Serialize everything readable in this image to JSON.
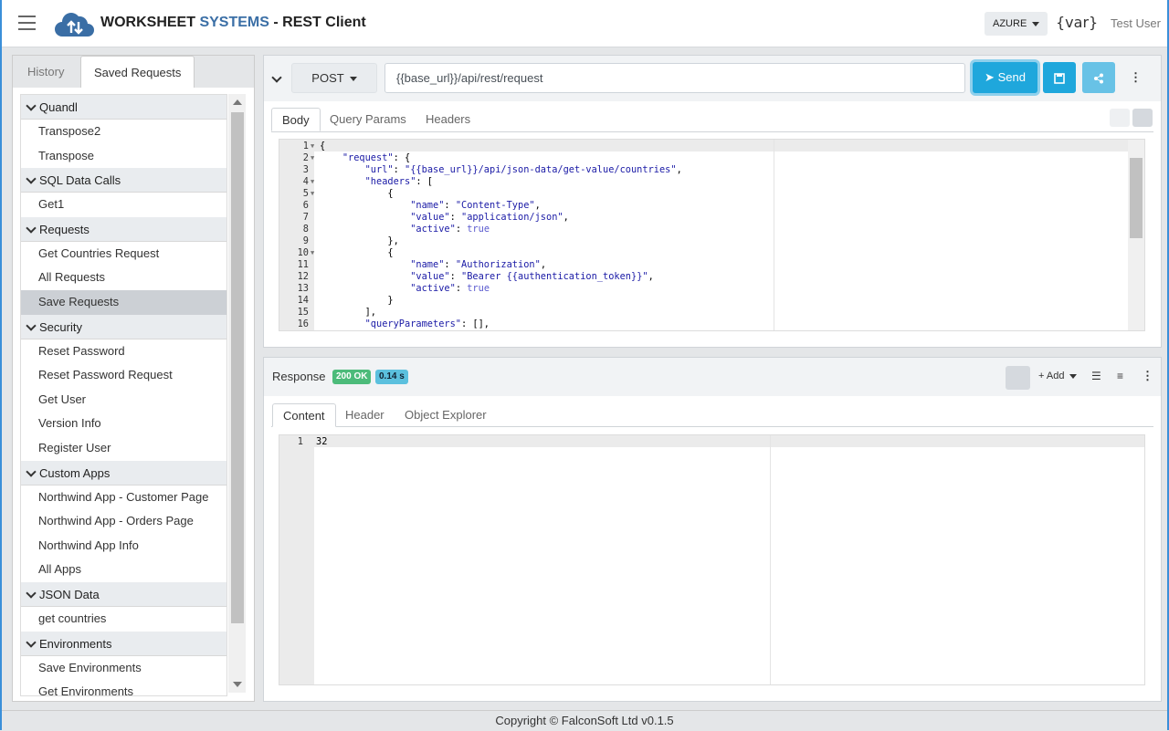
{
  "header": {
    "title_part1": "WORKSHEET",
    "title_part2": "SYSTEMS",
    "title_part3": "- REST Client",
    "environment": "AZURE",
    "var_label": "{var}",
    "user": "Test User"
  },
  "sidebar": {
    "tabs": [
      {
        "label": "History",
        "active": false
      },
      {
        "label": "Saved Requests",
        "active": true
      }
    ],
    "groups": [
      {
        "name": "Quandl",
        "items": [
          "Transpose2",
          "Transpose"
        ]
      },
      {
        "name": "SQL Data Calls",
        "items": [
          "Get1"
        ]
      },
      {
        "name": "Requests",
        "items": [
          "Get Countries Request",
          "All Requests",
          "Save Requests"
        ]
      },
      {
        "name": "Security",
        "items": [
          "Reset Password",
          "Reset Password Request",
          "Get User",
          "Version Info",
          "Register User"
        ]
      },
      {
        "name": "Custom Apps",
        "items": [
          "Northwind App - Customer Page",
          "Northwind App - Orders Page",
          "Northwind App Info",
          "All Apps"
        ]
      },
      {
        "name": "JSON Data",
        "items": [
          "get countries"
        ]
      },
      {
        "name": "Environments",
        "items": [
          "Save Environments",
          "Get Environments"
        ]
      }
    ],
    "selected": "Save Requests"
  },
  "request": {
    "method": "POST",
    "url": "{{base_url}}/api/rest/request",
    "send_label": "Send",
    "tabs": [
      "Body",
      "Query Params",
      "Headers"
    ],
    "active_tab": "Body",
    "body_lines": [
      "{",
      "    \"request\": {",
      "        \"url\": \"{{base_url}}/api/json-data/get-value/countries\",",
      "        \"headers\": [",
      "            {",
      "                \"name\": \"Content-Type\",",
      "                \"value\": \"application/json\",",
      "                \"active\": true",
      "            },",
      "            {",
      "                \"name\": \"Authorization\",",
      "                \"value\": \"Bearer {{authentication_token}}\",",
      "                \"active\": true",
      "            }",
      "        ],",
      "        \"queryParameters\": [],"
    ],
    "foldable_lines": [
      1,
      2,
      4,
      5,
      10
    ]
  },
  "response": {
    "label": "Response",
    "status": "200 OK",
    "time": "0.14 s",
    "add_label": "+ Add",
    "tabs": [
      "Content",
      "Header",
      "Object Explorer"
    ],
    "active_tab": "Content",
    "content_lines": [
      "32"
    ]
  },
  "footer": {
    "copyright": "Copyright © FalconSoft Ltd v0.1.5"
  },
  "colors": {
    "accent": "#1fa7dc",
    "success": "#4cbb7a",
    "info": "#5bc0de",
    "brand": "#3b6fa6"
  }
}
